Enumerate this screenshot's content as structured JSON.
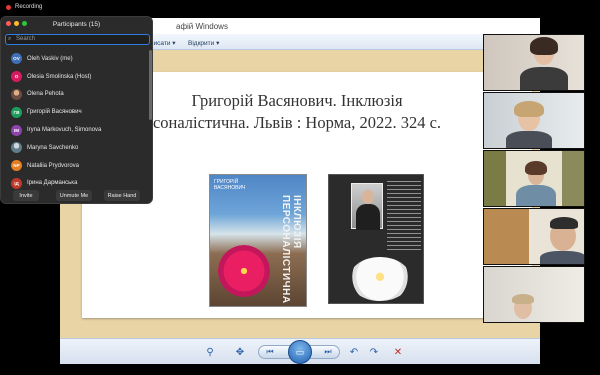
{
  "recording": {
    "label": "Recording",
    "color": "#e53935"
  },
  "viewer": {
    "title_fragment": "афій Windows",
    "toolbar": {
      "item1": "писати ▾",
      "item2": "Відкрити ▾"
    },
    "slide_title_line1": "Григорій Васянович. Інклюзія",
    "slide_title_line2": "соналістична. Львів : Норма, 2022. 324 с.",
    "book1_author": "ГРИГОРІЙ ВАСЯНОВИЧ",
    "book1_title": "ІНКЛЮЗІЯ ПЕРСОНАЛІСТИЧНА",
    "controls": {
      "zoom_icon": "⚲",
      "fit_icon": "✥",
      "prev_icon": "⏮",
      "slideshow_icon": "▭",
      "next_icon": "⏭",
      "rotate_ccw_icon": "↶",
      "rotate_cw_icon": "↷",
      "delete_icon": "✕"
    }
  },
  "participants_panel": {
    "title": "Participants (15)",
    "search_placeholder": "Search",
    "search_icon": "⌕",
    "participants": [
      {
        "initials": "OV",
        "name": "Oleh Vaskiv (me)",
        "color": "#3f6fb6"
      },
      {
        "initials": "O",
        "name": "Olesia Smolinska (Host)",
        "color": "#d81b60"
      },
      {
        "initials": "",
        "name": "Olena Pehota",
        "color": "#8d6e63"
      },
      {
        "initials": "ГВ",
        "name": "Григорій Васянович",
        "color": "#1e9e5c"
      },
      {
        "initials": "IM",
        "name": "Iryna Markovuch, Simonova",
        "color": "#8e44ad"
      },
      {
        "initials": "",
        "name": "Maryna Savchenko",
        "color": "#7d8a99"
      },
      {
        "initials": "NP",
        "name": "Nataliia Prydvorova",
        "color": "#e67e22"
      },
      {
        "initials": "ІД",
        "name": "Ірина Дарманська",
        "color": "#c0392b"
      }
    ],
    "footer": {
      "invite": "Invite",
      "unmute": "Unmute Me",
      "raise_hand": "Raise Hand"
    },
    "traffic_lights": [
      "#ff5f57",
      "#febc2e",
      "#28c840"
    ]
  }
}
